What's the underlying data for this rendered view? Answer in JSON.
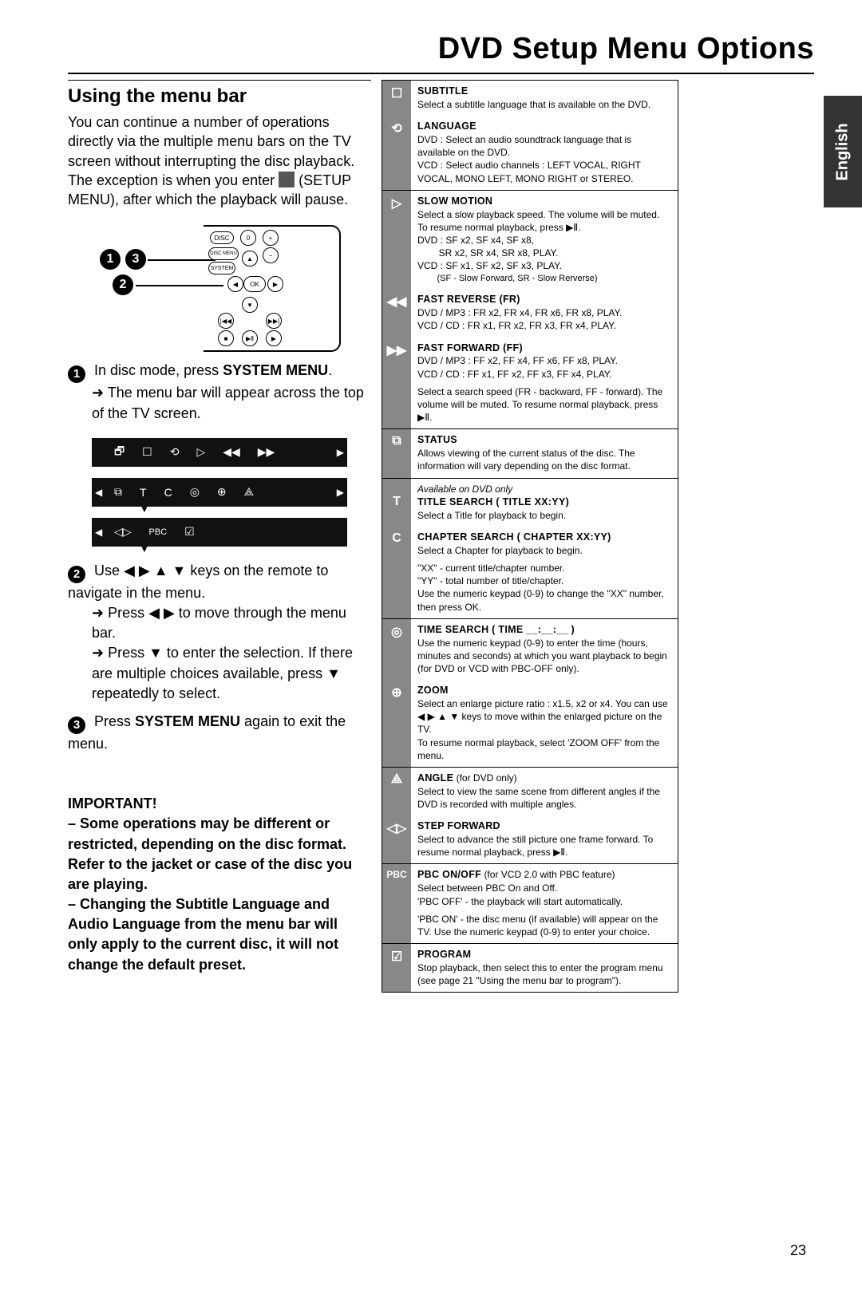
{
  "page_title": "DVD Setup Menu Options",
  "language_tab": "English",
  "page_number": "23",
  "left": {
    "subtitle": "Using the menu bar",
    "intro_1": "You can continue a number of operations directly via the multiple menu bars on the TV screen without interrupting the disc playback. The exception is when you enter ",
    "intro_setupmenu": " (SETUP MENU), after which the playback will pause.",
    "callouts": {
      "c1": "1",
      "c2": "2",
      "c3": "3"
    },
    "step1_prefix": "In disc mode, press ",
    "step1_bold": "SYSTEM MENU",
    "step1_suffix": ".",
    "step1_sub": "The menu bar will appear across the top of the TV screen.",
    "step2_a": "Use ◀ ▶ ▲ ▼ keys on the remote to navigate in the menu.",
    "step2_b": "Press ◀ ▶ to move through the menu bar.",
    "step2_c": "Press ▼ to enter the selection. If there are multiple choices available, press ▼ repeatedly to select.",
    "step3_a": "Press ",
    "step3_bold": "SYSTEM MENU",
    "step3_b": " again to exit the menu.",
    "important_heading": "IMPORTANT!",
    "important_p1": "– Some operations may be different or restricted, depending on the disc format. Refer to the jacket or case of the disc you are playing.",
    "important_p2": "– Changing the Subtitle Language and Audio Language from the menu bar will only apply to the current disc, it will not change the default preset.",
    "menubar_icons": {
      "row1": [
        "🗗",
        "⟲",
        "▷",
        "◀◀",
        "▶▶"
      ],
      "row2": [
        "⧉",
        "T",
        "C",
        "◎",
        "⊕",
        "⟁"
      ],
      "row3": [
        "◁▷",
        "PBC",
        "☑"
      ]
    }
  },
  "ref": {
    "subtitle": {
      "title": "SUBTITLE",
      "body": "Select a subtitle language that is available on the DVD."
    },
    "language": {
      "title": "LANGUAGE",
      "body1": "DVD : Select an audio soundtrack language that is available on the DVD.",
      "body2": "VCD : Select audio channels : LEFT VOCAL, RIGHT VOCAL, MONO LEFT, MONO RIGHT or STEREO."
    },
    "slowmotion": {
      "title": "SLOW MOTION",
      "body1": "Select a slow playback speed. The volume will be muted. To resume normal playback, press ▶Ⅱ.",
      "body2": "DVD : SF x2, SF x4, SF x8,",
      "body3": "        SR x2, SR x4, SR x8, PLAY.",
      "body4": "VCD : SF x1, SF x2, SF x3, PLAY.",
      "body5": "        (SF - Slow Forward, SR - Slow Rerverse)"
    },
    "fastrev": {
      "title": "FAST REVERSE (FR)",
      "body1": "DVD / MP3 : FR x2, FR x4, FR x6, FR x8, PLAY.",
      "body2": "VCD / CD : FR x1, FR x2, FR x3, FR x4, PLAY."
    },
    "fastfwd": {
      "title": "FAST FORWARD (FF)",
      "body1": "DVD / MP3 : FF x2, FF x4, FF x6, FF x8, PLAY.",
      "body2": "VCD / CD : FF x1, FF x2, FF x3, FF x4, PLAY.",
      "body3": "Select a search speed (FR - backward, FF - forward). The volume will be muted. To resume normal playback, press ▶Ⅱ."
    },
    "status": {
      "title": "STATUS",
      "body": "Allows viewing of the current status of the disc. The information will vary depending on the disc format."
    },
    "titlesearch": {
      "note": "Available on DVD only",
      "title": "TITLE SEARCH ( TITLE XX:YY)",
      "body": "Select a Title for playback to begin."
    },
    "chaptersearch": {
      "title": "CHAPTER SEARCH ( CHAPTER XX:YY)",
      "body1": "Select a Chapter for playback to begin.",
      "body2": "\"XX\" - current title/chapter number.",
      "body3": "\"YY\" - total number of title/chapter.",
      "body4": "Use the numeric keypad (0-9) to change the \"XX\" number, then press OK."
    },
    "timesearch": {
      "title": "TIME SEARCH ( TIME __:__:__ )",
      "body": "Use the numeric keypad (0-9) to enter the time (hours, minutes and seconds) at which you want playback to begin (for DVD or VCD with PBC-OFF only)."
    },
    "zoom": {
      "title": "ZOOM",
      "body1": "Select an enlarge picture ratio : x1.5, x2 or x4. You can use ◀ ▶ ▲ ▼ keys to move within the enlarged picture on the TV.",
      "body2": "To resume normal playback, select 'ZOOM OFF' from the menu."
    },
    "angle": {
      "title": "ANGLE (for DVD only)",
      "body": "Select to view the same scene from different angles if the DVD is recorded with multiple angles."
    },
    "stepfwd": {
      "title": "STEP FORWARD",
      "body": "Select to advance the still picture one frame forward. To resume normal playback, press ▶Ⅱ."
    },
    "pbc": {
      "title": "PBC ON/OFF (for VCD 2.0 with PBC feature)",
      "body1": "Select between PBC On and Off.",
      "body2": "'PBC OFF' - the playback will start automatically.",
      "body3": "'PBC ON' - the disc menu (if available) will appear on the TV. Use the numeric keypad (0-9) to enter your choice."
    },
    "program": {
      "title": "PROGRAM",
      "body": "Stop playback, then select this to enter the program menu (see page 21 \"Using the menu bar to program\")."
    }
  }
}
